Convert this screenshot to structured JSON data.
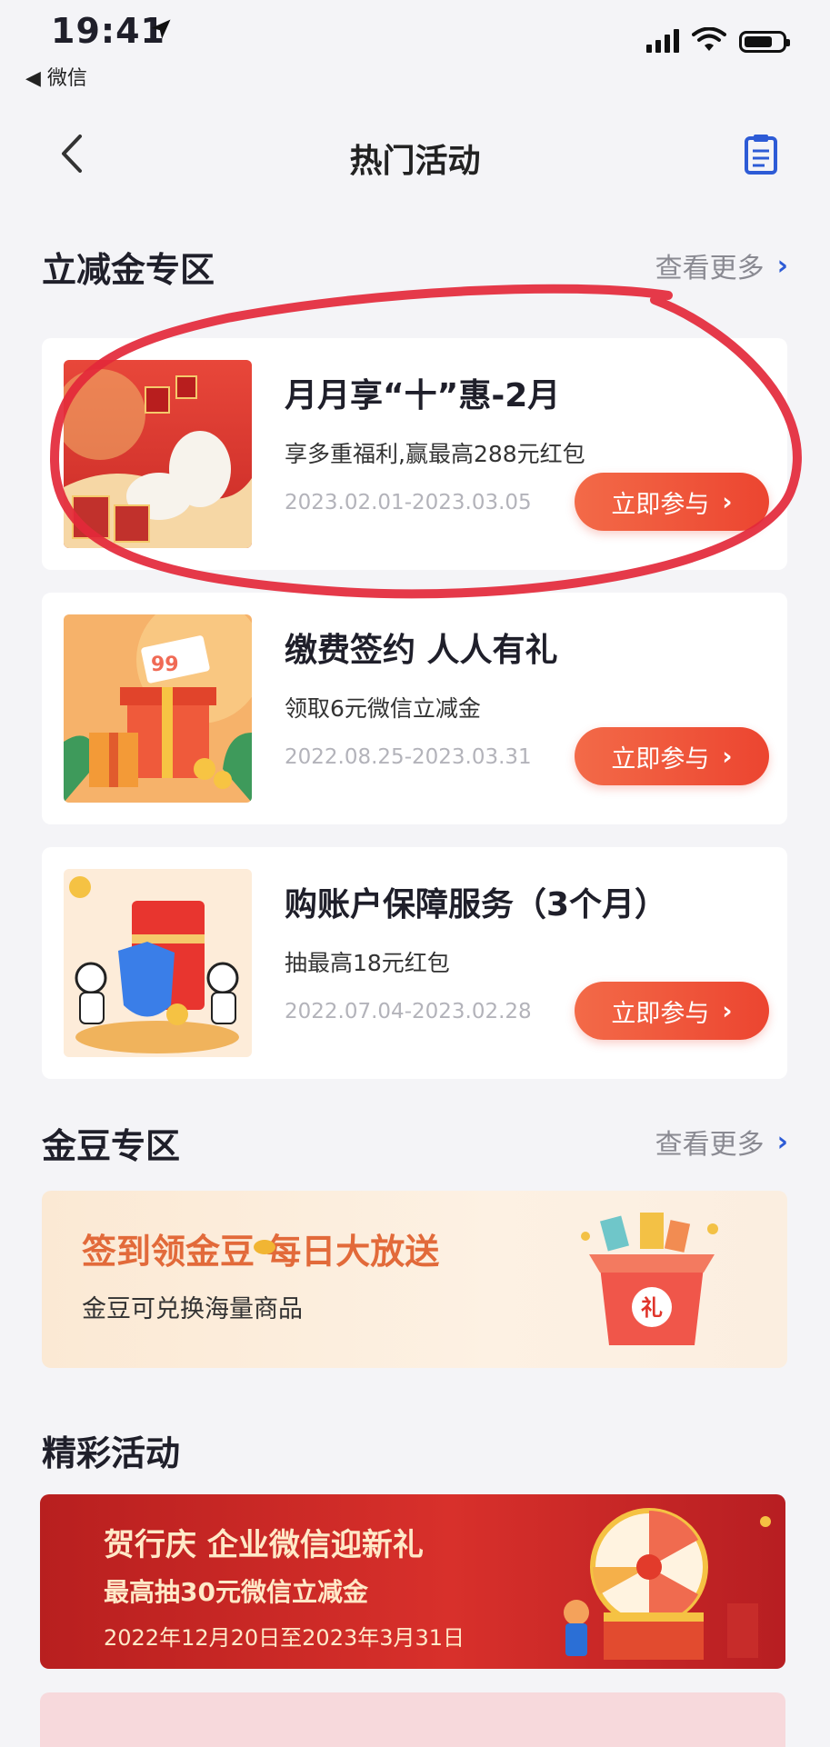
{
  "status_bar": {
    "time": "19:41",
    "back_app": "◀ 微信",
    "icons": [
      "location-arrow-icon",
      "signal-icon",
      "wifi-icon",
      "battery-icon"
    ]
  },
  "nav": {
    "title": "热门活动",
    "back_icon": "chevron-left-icon",
    "right_icon": "clipboard-icon"
  },
  "discount_section": {
    "title": "立减金专区",
    "more_label": "查看更多",
    "cards": [
      {
        "title": "月月享“十”惠-2月",
        "desc": "享多重福利,赢最高288元红包",
        "date": "2023.02.01-2023.03.05",
        "button": "立即参与"
      },
      {
        "title": "缴费签约 人人有礼",
        "desc": "领取6元微信立减金",
        "date": "2022.08.25-2023.03.31",
        "button": "立即参与"
      },
      {
        "title": "购账户保障服务（3个月）",
        "desc": "抽最高18元红包",
        "date": "2022.07.04-2023.02.28",
        "button": "立即参与"
      }
    ]
  },
  "beans_section": {
    "title": "金豆专区",
    "more_label": "查看更多",
    "banner_title": "签到领金豆 每日大放送",
    "banner_sub": "金豆可兑换海量商品",
    "gift_label": "礼"
  },
  "featured_section": {
    "title": "精彩活动",
    "banner_title": "贺行庆 企业微信迎新礼",
    "banner_sub": "最高抽30元微信立减金",
    "banner_date": "2022年12月20日至2023年3月31日"
  },
  "colors": {
    "accent_red": "#ec4530",
    "link_blue": "#2d5bd6",
    "annotation_red": "#e3283a"
  }
}
